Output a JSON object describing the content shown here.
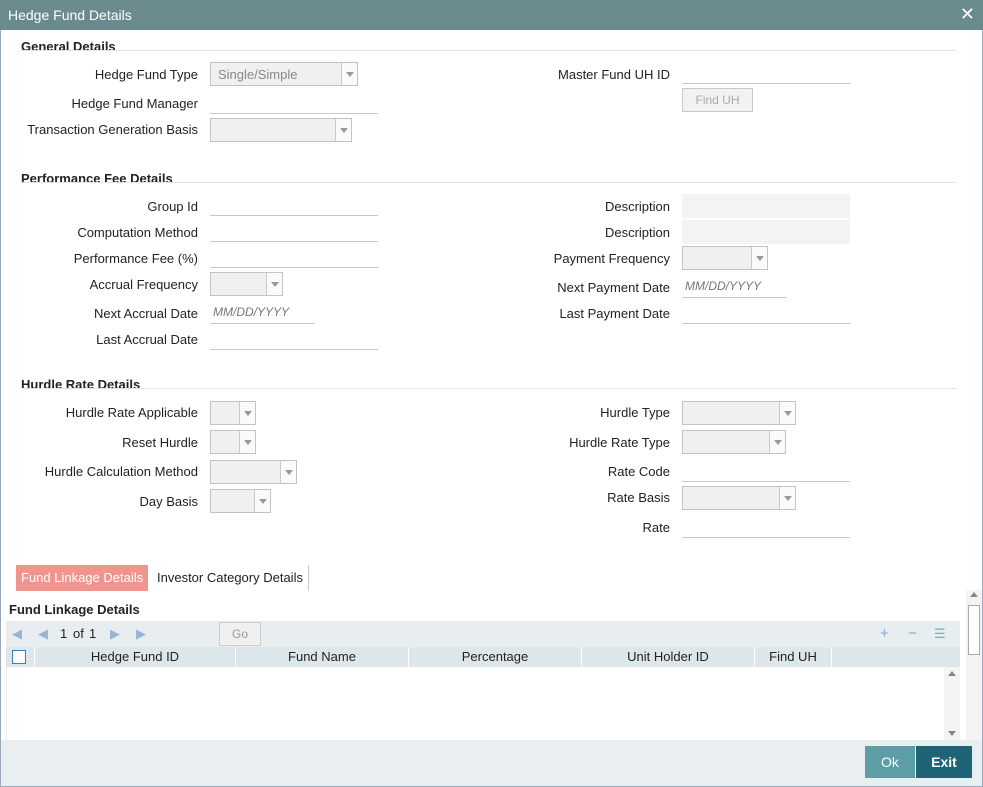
{
  "window": {
    "title": "Hedge Fund Details",
    "close_glyph": "✕"
  },
  "general": {
    "title": "General Details",
    "hedge_fund_type_label": "Hedge Fund Type",
    "hedge_fund_type_value": "Single/Simple",
    "hedge_fund_manager_label": "Hedge Fund Manager",
    "transaction_generation_basis_label": "Transaction Generation Basis",
    "master_fund_uh_id_label": "Master Fund UH ID",
    "find_uh_label": "Find UH"
  },
  "performance": {
    "title": "Performance Fee Details",
    "group_id_label": "Group Id",
    "computation_method_label": "Computation Method",
    "performance_fee_label": "Performance Fee (%)",
    "accrual_frequency_label": "Accrual Frequency",
    "next_accrual_date_label": "Next Accrual Date",
    "next_accrual_date_placeholder": "MM/DD/YYYY",
    "last_accrual_date_label": "Last Accrual Date",
    "description1_label": "Description",
    "description2_label": "Description",
    "payment_frequency_label": "Payment Frequency",
    "next_payment_date_label": "Next Payment Date",
    "next_payment_date_placeholder": "MM/DD/YYYY",
    "last_payment_date_label": "Last Payment Date"
  },
  "hurdle": {
    "title": "Hurdle Rate Details",
    "hurdle_rate_applicable_label": "Hurdle Rate Applicable",
    "reset_hurdle_label": "Reset Hurdle",
    "hurdle_calculation_method_label": "Hurdle Calculation Method",
    "day_basis_label": "Day Basis",
    "hurdle_type_label": "Hurdle Type",
    "hurdle_rate_type_label": "Hurdle Rate Type",
    "rate_code_label": "Rate Code",
    "rate_basis_label": "Rate Basis",
    "rate_label": "Rate"
  },
  "tabs": [
    {
      "label": "Fund Linkage Details",
      "active": true
    },
    {
      "label": "Investor Category Details",
      "active": false
    }
  ],
  "grid": {
    "title": "Fund Linkage Details",
    "page_current": "1",
    "page_of": "of",
    "page_total": "1",
    "go_label": "Go",
    "columns": [
      "Hedge Fund ID",
      "Fund Name",
      "Percentage",
      "Unit Holder ID",
      "Find UH"
    ]
  },
  "footer": {
    "ok_label": "Ok",
    "exit_label": "Exit"
  },
  "colors": {
    "titlebar": "#6b8a8e",
    "active_tab": "#f0958d",
    "ok": "#5d9ea6",
    "exit": "#1d6576"
  }
}
